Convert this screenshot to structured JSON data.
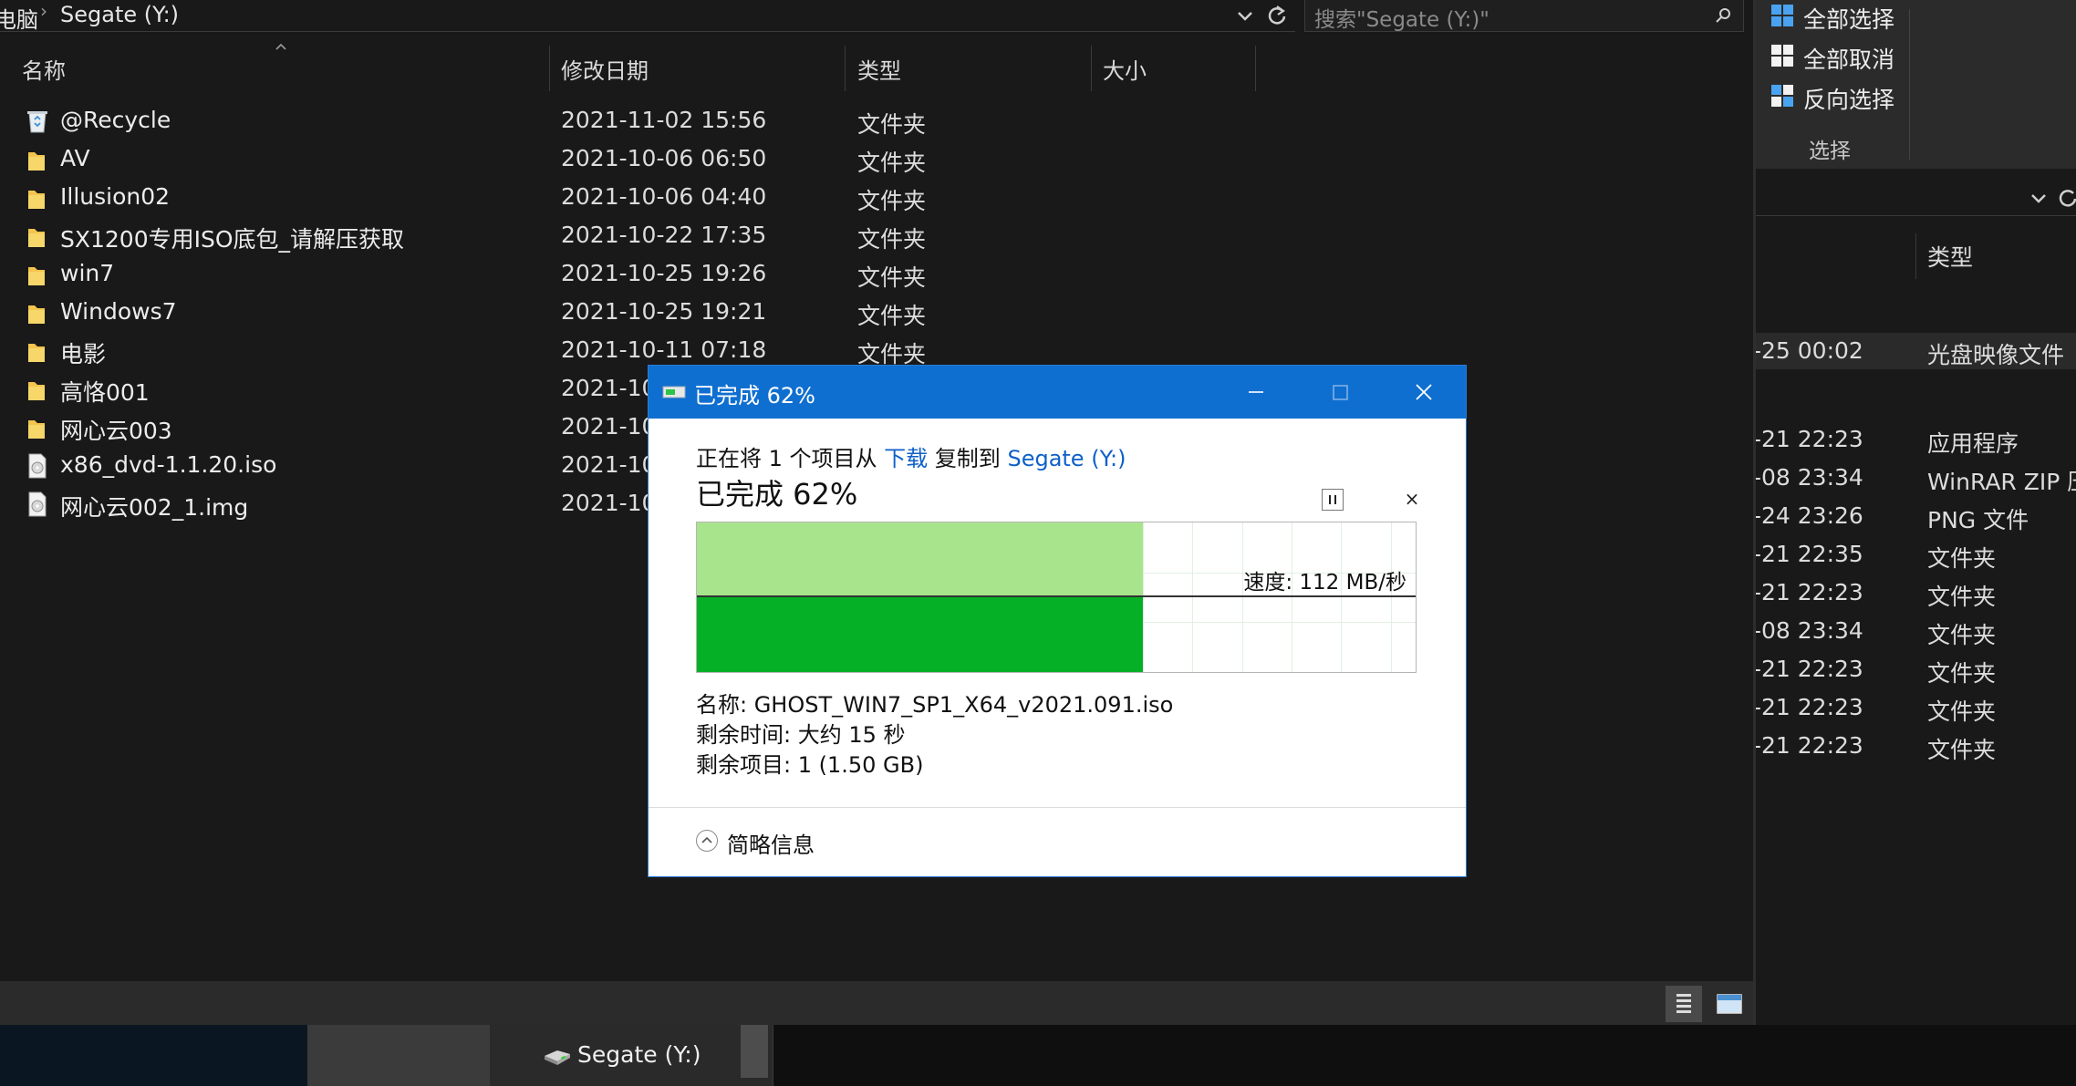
{
  "address_bar": {
    "breadcrumb_parent": "电脑",
    "separator": "›",
    "current": "Segate (Y:)",
    "search_placeholder": "搜索\"Segate (Y:)\""
  },
  "columns": {
    "name": "名称",
    "modified": "修改日期",
    "type": "类型",
    "size": "大小"
  },
  "files": [
    {
      "name": "@Recycle",
      "date": "2021-11-02 15:56",
      "type": "文件夹",
      "icon": "recycle-bin-icon"
    },
    {
      "name": "AV",
      "date": "2021-10-06 06:50",
      "type": "文件夹",
      "icon": "folder-icon"
    },
    {
      "name": "Illusion02",
      "date": "2021-10-06 04:40",
      "type": "文件夹",
      "icon": "folder-icon"
    },
    {
      "name": "SX1200专用ISO底包_请解压获取",
      "date": "2021-10-22 17:35",
      "type": "文件夹",
      "icon": "folder-icon"
    },
    {
      "name": "win7",
      "date": "2021-10-25 19:26",
      "type": "文件夹",
      "icon": "folder-icon"
    },
    {
      "name": "Windows7",
      "date": "2021-10-25 19:21",
      "type": "文件夹",
      "icon": "folder-icon"
    },
    {
      "name": "电影",
      "date": "2021-10-11 07:18",
      "type": "文件夹",
      "icon": "folder-icon"
    },
    {
      "name": "高恪001",
      "date": "2021-10",
      "type": "",
      "icon": "folder-icon"
    },
    {
      "name": "网心云003",
      "date": "2021-10",
      "type": "",
      "icon": "folder-icon"
    },
    {
      "name": "x86_dvd-1.1.20.iso",
      "date": "2021-10",
      "type": "",
      "icon": "disc-image-icon"
    },
    {
      "name": "网心云002_1.img",
      "date": "2021-10",
      "type": "",
      "icon": "disc-image-icon"
    }
  ],
  "ribbon": {
    "select_all": "全部选择",
    "select_none": "全部取消",
    "invert_selection": "反向选择",
    "group_label": "选择"
  },
  "right_pane": {
    "type_header": "类型",
    "rows": [
      {
        "date": "-25 00:02",
        "type": "光盘映像文件"
      },
      {
        "date": "-21 22:23",
        "type": "应用程序"
      },
      {
        "date": "-08 23:34",
        "type": "WinRAR ZIP 压"
      },
      {
        "date": "-24 23:26",
        "type": "PNG 文件"
      },
      {
        "date": "-21 22:35",
        "type": "文件夹"
      },
      {
        "date": "-21 22:23",
        "type": "文件夹"
      },
      {
        "date": "-08 23:34",
        "type": "文件夹"
      },
      {
        "date": "-21 22:23",
        "type": "文件夹"
      },
      {
        "date": "-21 22:23",
        "type": "文件夹"
      },
      {
        "date": "-21 22:23",
        "type": "文件夹"
      }
    ]
  },
  "dialog": {
    "title": "已完成 62%",
    "copy_prefix": "正在将 1 个项目从",
    "source": "下载",
    "copy_mid": "复制到",
    "destination": "Segate (Y:)",
    "percent_text": "已完成 62%",
    "progress": 0.62,
    "speed_text": "速度: 112 MB/秒",
    "name_line": "名称:  GHOST_WIN7_SP1_X64_v2021.091.iso",
    "time_line": "剩余时间: 大约 15 秒",
    "items_line": "剩余项目: 1 (1.50 GB)",
    "less_info": "简略信息",
    "stop_glyph": "×"
  },
  "taskbar": {
    "active_item": "Segate (Y:)"
  },
  "colors": {
    "accent": "#0f6fd0",
    "progress_light": "#a8e48c",
    "progress_dark": "#06b026",
    "explorer_bg": "#191919"
  }
}
